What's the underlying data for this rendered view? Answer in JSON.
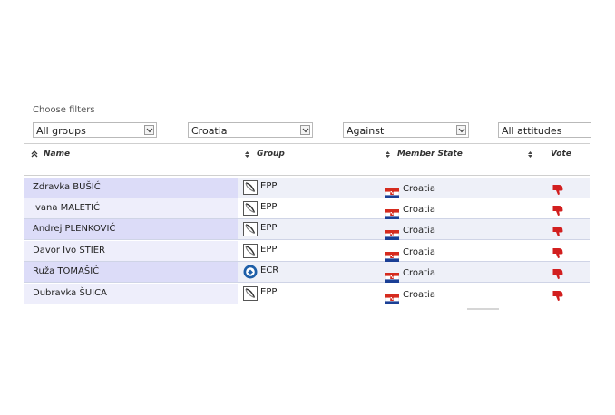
{
  "filters": {
    "title": "Choose filters",
    "group_select": "All groups",
    "country_select": "Croatia",
    "vote_select": "Against",
    "attitude_select": "All attitudes"
  },
  "table": {
    "headers": {
      "name": "Name",
      "group": "Group",
      "member_state": "Member State",
      "vote": "Vote"
    },
    "rows": [
      {
        "name": "Zdravka BUŠIĆ",
        "group": "EPP",
        "group_icon": "epp-logo-icon",
        "state": "Croatia",
        "vote": "thumbs-down-icon"
      },
      {
        "name": "Ivana MALETIĆ",
        "group": "EPP",
        "group_icon": "epp-logo-icon",
        "state": "Croatia",
        "vote": "thumbs-down-icon"
      },
      {
        "name": "Andrej PLENKOVIĆ",
        "group": "EPP",
        "group_icon": "epp-logo-icon",
        "state": "Croatia",
        "vote": "thumbs-down-icon"
      },
      {
        "name": "Davor Ivo STIER",
        "group": "EPP",
        "group_icon": "epp-logo-icon",
        "state": "Croatia",
        "vote": "thumbs-down-icon"
      },
      {
        "name": "Ruža TOMAŠIĆ",
        "group": "ECR",
        "group_icon": "ecr-logo-icon",
        "state": "Croatia",
        "vote": "thumbs-down-icon"
      },
      {
        "name": "Dubravka ŠUICA",
        "group": "EPP",
        "group_icon": "epp-logo-icon",
        "state": "Croatia",
        "vote": "thumbs-down-icon"
      }
    ]
  },
  "colors": {
    "vote_against": "#d21f1f",
    "name_col_shade": "#dcdcf8",
    "row_shade": "#eef0f8"
  }
}
